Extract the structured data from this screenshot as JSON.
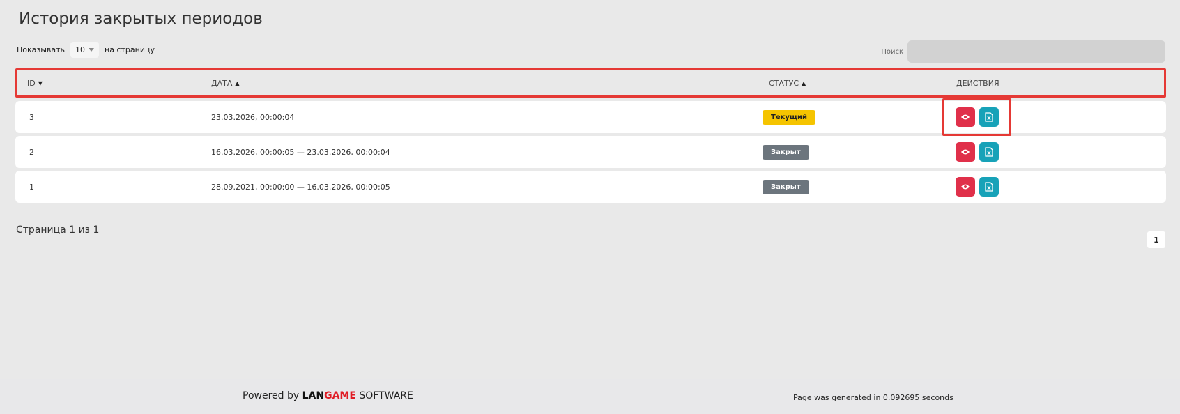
{
  "page": {
    "title": "История закрытых периодов"
  },
  "length": {
    "prefix": "Показывать",
    "value": "10",
    "suffix": "на страницу"
  },
  "search": {
    "label": "Поиск",
    "placeholder": ""
  },
  "table": {
    "columns": {
      "id": "ID",
      "date": "ДАТА",
      "status": "СТАТУС",
      "actions": "ДЕЙСТВИЯ"
    },
    "rows": [
      {
        "id": "3",
        "date": "23.03.2026, 00:00:04",
        "status": "Текущий",
        "status_type": "current"
      },
      {
        "id": "2",
        "date": "16.03.2026, 00:00:05 — 23.03.2026, 00:00:04",
        "status": "Закрыт",
        "status_type": "closed"
      },
      {
        "id": "1",
        "date": "28.09.2021, 00:00:00 — 16.03.2026, 00:00:05",
        "status": "Закрыт",
        "status_type": "closed"
      }
    ]
  },
  "pagination": {
    "info": "Страница 1 из 1",
    "current_page": "1"
  },
  "footer": {
    "powered_prefix": "Powered by",
    "logo_lan": "LAN",
    "logo_game": "GAME",
    "logo_suffix": "SOFTWARE",
    "generated": "Page was generated in 0.092695 seconds"
  },
  "colors": {
    "highlight": "#e53935",
    "view_button": "#e0304a",
    "excel_button": "#17a2b8",
    "badge_current": "#f5c400",
    "badge_closed": "#6c757d"
  },
  "icons": {
    "view": "eye-icon",
    "excel": "file-excel-icon",
    "sort": "sort-icon"
  }
}
